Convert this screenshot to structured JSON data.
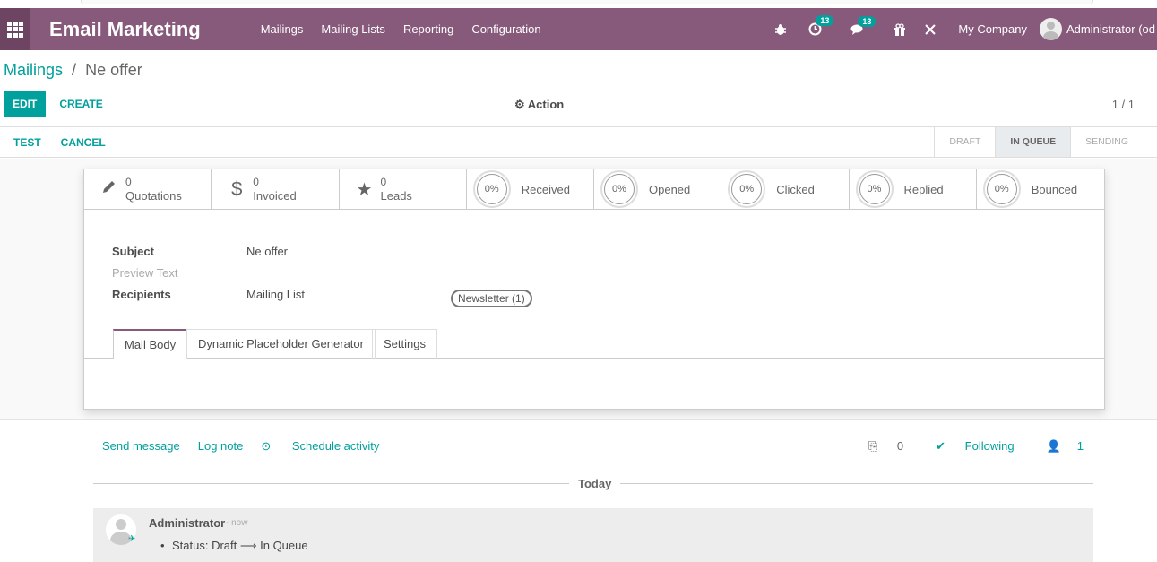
{
  "navbar": {
    "app_title": "Email Marketing",
    "menu": [
      "Mailings",
      "Mailing Lists",
      "Reporting",
      "Configuration"
    ],
    "activity_badge": "13",
    "messages_badge": "13",
    "company": "My Company",
    "user": "Administrator (od"
  },
  "breadcrumb": {
    "parent": "Mailings",
    "separator": "/",
    "current": "Ne offer"
  },
  "control": {
    "edit": "EDIT",
    "create": "CREATE",
    "action": "Action",
    "pager": "1 / 1"
  },
  "statusbar": {
    "test": "TEST",
    "cancel": "CANCEL",
    "stages": [
      "DRAFT",
      "IN QUEUE",
      "SENDING"
    ],
    "active_stage": "IN QUEUE"
  },
  "smart_buttons": {
    "quotations": {
      "value": "0",
      "label": "Quotations"
    },
    "invoiced": {
      "value": "0",
      "label": "Invoiced"
    },
    "leads": {
      "value": "0",
      "label": "Leads"
    },
    "received": {
      "value": "0%",
      "label": "Received"
    },
    "opened": {
      "value": "0%",
      "label": "Opened"
    },
    "clicked": {
      "value": "0%",
      "label": "Clicked"
    },
    "replied": {
      "value": "0%",
      "label": "Replied"
    },
    "bounced": {
      "value": "0%",
      "label": "Bounced"
    }
  },
  "form": {
    "subject_label": "Subject",
    "subject_value": "Ne offer",
    "preview_label": "Preview Text",
    "recipients_label": "Recipients",
    "recipients_value": "Mailing List",
    "mailing_list_tag": "Newsletter (1)"
  },
  "tabs": [
    "Mail Body",
    "Dynamic Placeholder Generator",
    "Settings"
  ],
  "chatter": {
    "send_message": "Send message",
    "log_note": "Log note",
    "schedule_activity": "Schedule activity",
    "attachments": "0",
    "following": "Following",
    "followers": "1",
    "today": "Today",
    "message": {
      "author": "Administrator",
      "date": "- now",
      "body": "Status: Draft ⟶ In Queue"
    }
  }
}
